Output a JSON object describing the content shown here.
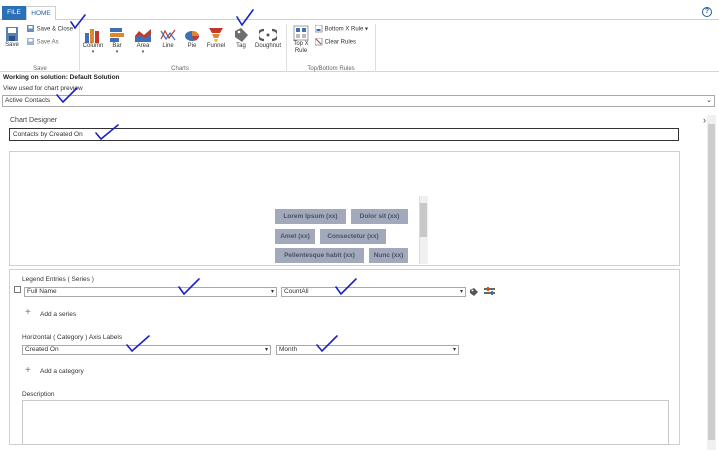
{
  "tabs": {
    "file": "FILE",
    "home": "HOME"
  },
  "ribbon": {
    "save": {
      "label": "Save"
    },
    "save_close": "Save & Close",
    "save_as": "Save As",
    "group_save": "Save",
    "charts": [
      "Column",
      "Bar",
      "Area",
      "Line",
      "Pie",
      "Funnel",
      "Tag",
      "Doughnut"
    ],
    "group_charts": "Charts",
    "top_x_rule": [
      "Top X",
      "Rule"
    ],
    "bottom_x_rule": "Bottom X Rule",
    "clear_rules": "Clear Rules",
    "group_topbottom": "Top/Bottom Rules"
  },
  "solution": "Working on solution: Default Solution",
  "view_label": "View used for chart preview",
  "view_value": "Active Contacts",
  "designer_title": "Chart Designer",
  "chart_name": "Contacts  by Created On",
  "tags": [
    "Lorem Ipsum (xx)",
    "Dolor sit (xx)",
    "Amet (xx)",
    "Consectetur  (xx)",
    "Pellentesque habit   (xx)",
    "Nunc (xx)"
  ],
  "legend_label": "Legend Entries ( Series )",
  "series_field": "Full Name",
  "series_aggregate": "CountAll",
  "add_series": "Add a series",
  "category_label": "Horizontal ( Category ) Axis Labels",
  "category_field": "Created On",
  "category_grouping": "Month",
  "add_category": "Add a category",
  "description_label": "Description",
  "colors": {
    "file_tab": "#2b6fb5",
    "tag_bg": "#a2a9bb",
    "check_ink": "#1a22c8"
  }
}
